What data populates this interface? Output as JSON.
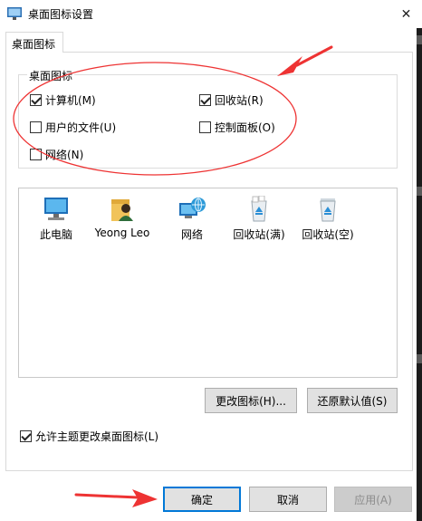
{
  "window": {
    "title": "桌面图标设置"
  },
  "tabs": [
    {
      "label": "桌面图标"
    }
  ],
  "group": {
    "title": "桌面图标"
  },
  "checkboxes": [
    {
      "label": "计算机(M)",
      "checked": true
    },
    {
      "label": "回收站(R)",
      "checked": true
    },
    {
      "label": "用户的文件(U)",
      "checked": false
    },
    {
      "label": "控制面板(O)",
      "checked": false
    },
    {
      "label": "网络(N)",
      "checked": false
    }
  ],
  "icons": [
    {
      "label": "此电脑",
      "icon": "computer-icon"
    },
    {
      "label": "Yeong Leo",
      "icon": "user-folder-icon"
    },
    {
      "label": "网络",
      "icon": "network-icon"
    },
    {
      "label": "回收站(满)",
      "icon": "recycle-bin-full-icon"
    },
    {
      "label": "回收站(空)",
      "icon": "recycle-bin-empty-icon"
    }
  ],
  "buttons": {
    "change_icon": "更改图标(H)...",
    "restore_default": "还原默认值(S)",
    "ok": "确定",
    "cancel": "取消",
    "apply": "应用(A)"
  },
  "allow_theme": {
    "label": "允许主题更改桌面图标(L)",
    "checked": true
  },
  "colors": {
    "annotation_red": "#ee3333",
    "accent_blue": "#0078d7"
  }
}
